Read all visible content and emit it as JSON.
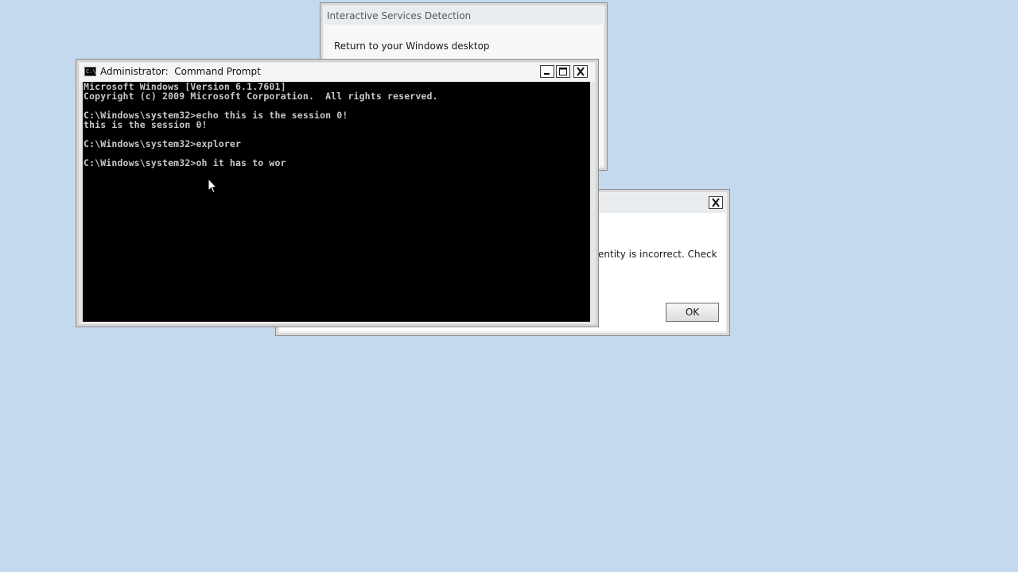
{
  "desktop": {
    "background": "#c4d9ee"
  },
  "isd_window": {
    "title": "Interactive Services Detection",
    "return_link": "Return to your Windows desktop"
  },
  "error_dialog": {
    "message": "entity is incorrect. Check",
    "ok_label": "OK",
    "close_icon": "close-icon"
  },
  "cmd_window": {
    "title": "Administrator:  Command Prompt",
    "icon_glyph": "C:\\",
    "buttons": [
      "minimize-icon",
      "maximize-icon",
      "close-icon"
    ],
    "lines": [
      "Microsoft Windows [Version 6.1.7601]",
      "Copyright (c) 2009 Microsoft Corporation.  All rights reserved.",
      "",
      "C:\\Windows\\system32>echo this is the session 0!",
      "this is the session 0!",
      "",
      "C:\\Windows\\system32>explorer",
      "",
      "C:\\Windows\\system32>oh it has to wor"
    ]
  }
}
